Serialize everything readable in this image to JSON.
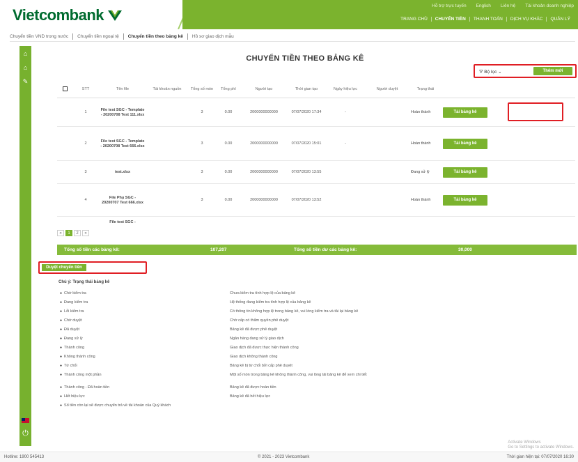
{
  "brand": {
    "name": "Vietcombank",
    "primary_color": "#7bb32e",
    "logo_color": "#006b2f",
    "highlight_color": "#e01e24"
  },
  "top_util": [
    "Hỗ trợ trực tuyến",
    "English",
    "Liên hệ",
    "Tài khoản doanh nghiệp"
  ],
  "main_nav": [
    {
      "label": "TRANG CHỦ",
      "active": false
    },
    {
      "label": "CHUYỂN TIỀN",
      "active": true
    },
    {
      "label": "THANH TOÁN",
      "active": false
    },
    {
      "label": "DỊCH VỤ KHÁC",
      "active": false
    },
    {
      "label": "QUẢN LÝ",
      "active": false
    }
  ],
  "subnav": [
    {
      "label": "Chuyển tiền VND trong nước",
      "active": false
    },
    {
      "label": "Chuyển tiền ngoại tệ",
      "active": false
    },
    {
      "label": "Chuyển tiền theo bảng kê",
      "active": true
    },
    {
      "label": "Hồ sơ giao dịch mẫu",
      "active": false
    }
  ],
  "page_title": "CHUYỂN TIỀN THEO BẢNG KÊ",
  "filter": {
    "label": "Bộ lọc",
    "button": "Thêm mới"
  },
  "table": {
    "headers": [
      "STT",
      "Tên file",
      "Tài khoản nguồn",
      "Tổng số món",
      "Tổng phí",
      "Người tạo",
      "Thời gian tạo",
      "Ngày hiệu lực",
      "Người duyệt",
      "Trạng thái"
    ],
    "rows": [
      {
        "stt": "1",
        "file": "File test SGC - Template - 20200708 Test 111.xlsx",
        "account": "",
        "count": "3",
        "fee": "0.00",
        "creator": "2000000000000",
        "created": "07/07/2020 17:34",
        "effective": "-",
        "approver": "",
        "status": "Hoàn thành",
        "action": "Tải bảng kê"
      },
      {
        "stt": "2",
        "file": "File test SGC - Template - 20200708 Test 666.xlsx",
        "account": "",
        "count": "3",
        "fee": "0.00",
        "creator": "2000000000000",
        "created": "07/07/2020 15:01",
        "effective": "-",
        "approver": "",
        "status": "Hoàn thành",
        "action": "Tải bảng kê"
      },
      {
        "stt": "3",
        "file": "test.xlsx",
        "account": "",
        "count": "3",
        "fee": "0.00",
        "creator": "2000000000000",
        "created": "07/07/2020 13:55",
        "effective": "",
        "approver": "",
        "status": "Đang xử lý",
        "action": "Tải bảng kê"
      },
      {
        "stt": "4",
        "file": "File Phụ SGC - 20200707 Test 666.xlsx",
        "account": "",
        "count": "3",
        "fee": "0.00",
        "creator": "2000000000000",
        "created": "07/07/2020 13:52",
        "effective": "",
        "approver": "",
        "status": "Hoàn thành",
        "action": "Tải bảng kê"
      },
      {
        "stt": "",
        "file": "File test SGC -",
        "account": "",
        "count": "",
        "fee": "",
        "creator": "",
        "created": "",
        "effective": "",
        "approver": "",
        "status": "",
        "action": ""
      }
    ]
  },
  "pager": {
    "prev": "«",
    "pages": [
      "1",
      "2"
    ],
    "next": "»",
    "current": "1"
  },
  "totals": {
    "label_left": "Tổng số tiền các bảng kê:",
    "value_left": "107,207",
    "label_right": "Tổng số tiền dư các bảng kê:",
    "value_right": "30,000"
  },
  "confirm_button": "Duyệt chuyển tiền",
  "legend_title": "Chú ý: Trạng thái bảng kê",
  "legend": [
    {
      "key": "Chờ kiểm tra",
      "value": "Chưa kiểm tra tính hợp lệ của bảng kê"
    },
    {
      "key": "Đang kiểm tra",
      "value": "Hệ thống đang kiểm tra tính hợp lệ của bảng kê"
    },
    {
      "key": "Lỗi kiểm tra",
      "value": "Có thông tin không hợp lệ trong bảng kê, vui lòng kiểm tra và tải lại bảng kê"
    },
    {
      "key": "Chờ duyệt",
      "value": "Chờ cấp có thẩm quyền phê duyệt"
    },
    {
      "key": "Đã duyệt",
      "value": "Bảng kê đã được phê duyệt"
    },
    {
      "key": "Đang xử lý",
      "value": "Ngân hàng đang xử lý giao dịch"
    },
    {
      "key": "Thành công",
      "value": "Giao dịch đã được thực hiện thành công"
    },
    {
      "key": "Không thành công",
      "value": "Giao dịch không thành công"
    },
    {
      "key": "Từ chối",
      "value": "Bảng kê bị từ chối bởi cấp phê duyệt"
    },
    {
      "key": "Thành công một phần",
      "value": "Một số món trong bảng kê không thành công, vui lòng tải bảng kê để xem chi tiết",
      "tall": true
    },
    {
      "key": "Thành công - Đã hoàn tiền",
      "value": "Bảng kê đã được hoàn tiền"
    },
    {
      "key": "Hết hiệu lực",
      "value": "Bảng kê đã hết hiệu lực"
    }
  ],
  "legend_note": "Số tiền còn lại sẽ được chuyển trả về tài khoản của Quý khách",
  "footer": {
    "hotline": "Hotline: 1900 545413",
    "copyright": "© 2021 - 2023 Vietcombank",
    "session": "Thời gian hiện tại: 07/07/2020 16:30"
  },
  "watermark": {
    "line1": "Activate Windows",
    "line2": "Go to Settings to activate Windows."
  }
}
